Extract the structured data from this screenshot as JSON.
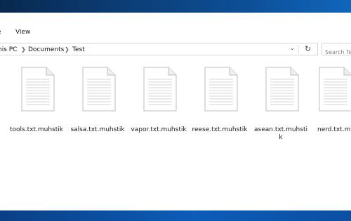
{
  "ribbon": {
    "tabs": [
      "e",
      "View"
    ]
  },
  "address": {
    "crumbs": [
      "his PC",
      "Documents",
      "Test"
    ],
    "dropdown_icon": "chevron-down-icon",
    "refresh_icon": "refresh-icon"
  },
  "search": {
    "placeholder": "Search Te"
  },
  "files": [
    {
      "name": "tools.txt.muhstik"
    },
    {
      "name": "salsa.txt.muhstik"
    },
    {
      "name": "vapor.txt.muhstik"
    },
    {
      "name": "reese.txt.muhstik"
    },
    {
      "name": "asean.txt.muhstik"
    },
    {
      "name": "nerd.txt.muhstik"
    }
  ]
}
